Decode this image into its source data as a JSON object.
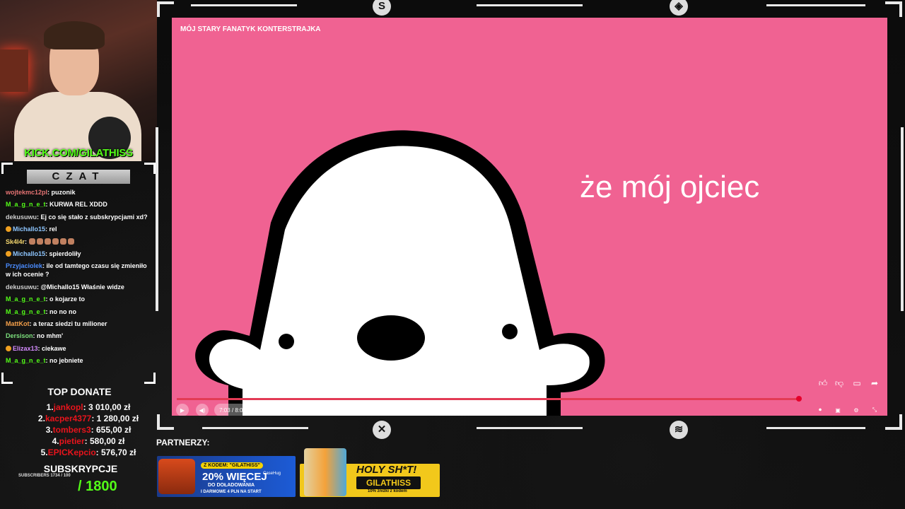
{
  "stream": {
    "kick_link_prefix": "KICK.COM/",
    "kick_link_name": "GILATHISS",
    "chat_header": "CZAT"
  },
  "chat": [
    {
      "user": "wojtekmc12pl",
      "color": "#e57373",
      "text": "puzonik",
      "badge": false
    },
    {
      "user": "M_a_g_n_e_t",
      "color": "#53fc18",
      "text": "KURWA REL XDDD",
      "badge": false
    },
    {
      "user": "dekusuwu",
      "color": "#cfcfcf",
      "text": "Ej co się stało z subskrypcjami xd?",
      "badge": false
    },
    {
      "user": "Michallo15",
      "color": "#8ec6ff",
      "text": "rel",
      "badge": true
    },
    {
      "user": "Sk4l4r",
      "color": "#f5d76e",
      "text": "",
      "badge": false,
      "emotes": 6
    },
    {
      "user": "Michallo15",
      "color": "#8ec6ff",
      "text": "spierdoliły",
      "badge": true
    },
    {
      "user": "Przyjaciolek",
      "color": "#4a8cff",
      "text": "ile od tamtego czasu się zmieniło w ich ocenie ?",
      "badge": false
    },
    {
      "user": "dekusuwu",
      "color": "#cfcfcf",
      "text": "@Michallo15 Właśnie widze",
      "badge": false
    },
    {
      "user": "M_a_g_n_e_t",
      "color": "#53fc18",
      "text": "o kojarze to",
      "badge": false
    },
    {
      "user": "M_a_g_n_e_t",
      "color": "#53fc18",
      "text": "no no no",
      "badge": false
    },
    {
      "user": "MattKot",
      "color": "#f5a04a",
      "text": "a teraz siedzi tu milioner",
      "badge": false
    },
    {
      "user": "Dersison",
      "color": "#7de07d",
      "text": "no mhm'",
      "badge": false
    },
    {
      "user": "Elizax13",
      "color": "#d58cff",
      "text": "ciekawe",
      "badge": true
    },
    {
      "user": "M_a_g_n_e_t",
      "color": "#53fc18",
      "text": "no jebniete",
      "badge": false
    }
  ],
  "donate": {
    "title": "TOP DONATE",
    "entries": [
      {
        "rank": "1.",
        "name": "jankopl",
        "amount": "3 010,00 zł"
      },
      {
        "rank": "2.",
        "name": "kacper4377",
        "amount": "1 280,00 zł"
      },
      {
        "rank": "3.",
        "name": "tombers3",
        "amount": "655,00 zł"
      },
      {
        "rank": "4.",
        "name": "pietier",
        "amount": "580,00 zł"
      },
      {
        "rank": "5.",
        "name": "EPICKepcio",
        "amount": "576,70 zł"
      }
    ]
  },
  "subs": {
    "title": "SUBSKRYPCJE",
    "small": "SUBSCRIBERS 1734 / 100",
    "goal": "/ 1800"
  },
  "video": {
    "title": "MÓJ STARY FANATYK KONTERSTRAJKA",
    "subtitle": "że mój ojciec",
    "time": "7:03 / 8:00",
    "progress": 0.88,
    "background": "#f06292",
    "progress_color": "#e5002b"
  },
  "partners": {
    "label": "PARTNERZY:",
    "ad1": {
      "code": "Z KODEM: \"GILATHISS\"",
      "headline": "20% WIĘCEJ",
      "line2": "DO DOŁADOWANIA",
      "line3": "I DARMOWE 4 PLN NA START",
      "brand": "CaseHug"
    },
    "ad2": {
      "headline": "HOLY SH*T!",
      "code": "GILATHISS",
      "note": "10% zniżki z kodem"
    }
  },
  "icons": [
    "play-icon",
    "volume-icon",
    "thumbs-up-icon",
    "thumbs-down-icon",
    "comment-icon",
    "share-icon",
    "autoplay-toggle-icon",
    "captions-icon",
    "settings-icon",
    "minimize-icon",
    "chevron-up-icon"
  ]
}
